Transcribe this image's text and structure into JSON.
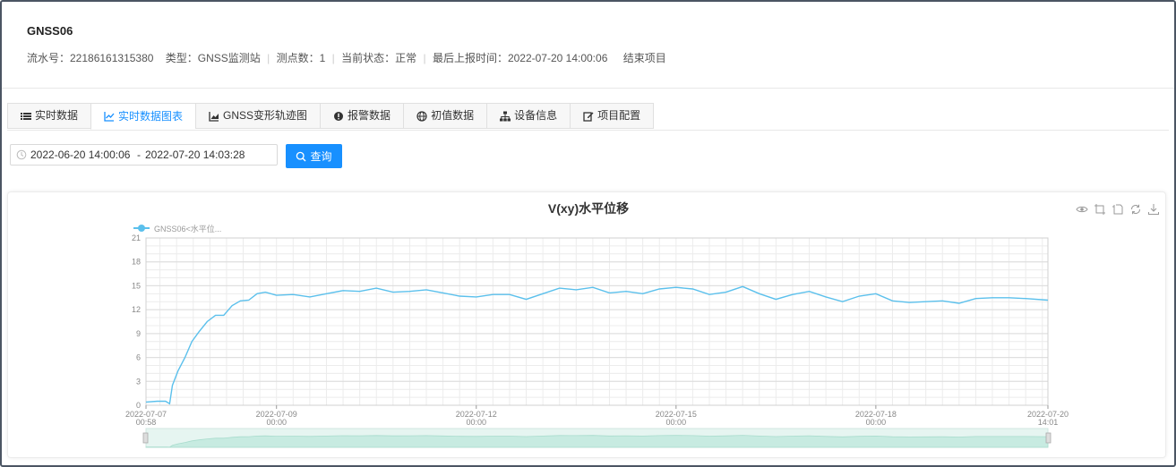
{
  "header": {
    "title": "GNSS06",
    "serial": "流水号：22186161315380",
    "type": "类型：GNSS监测站",
    "points": "测点数：1",
    "status": "当前状态：正常",
    "last_report": "最后上报时间：2022-07-20 14:00:06",
    "end_link": "结束项目"
  },
  "tabs": [
    {
      "label": "实时数据",
      "icon": "list-icon"
    },
    {
      "label": "实时数据图表",
      "icon": "line-chart-icon",
      "active": true
    },
    {
      "label": "GNSS变形轨迹图",
      "icon": "area-chart-icon"
    },
    {
      "label": "报警数据",
      "icon": "alert-icon"
    },
    {
      "label": "初值数据",
      "icon": "globe-icon"
    },
    {
      "label": "设备信息",
      "icon": "sitemap-icon"
    },
    {
      "label": "项目配置",
      "icon": "edit-icon"
    }
  ],
  "filter": {
    "start": "2022-06-20 14:00:06",
    "end": "2022-07-20 14:03:28",
    "range_sep": "-",
    "query_label": "查询"
  },
  "colors": {
    "accent": "#1890ff",
    "series": "#5bc0ec"
  },
  "toolbox": [
    "eye-icon",
    "zoom-select-icon",
    "zoom-reset-icon",
    "restore-icon",
    "download-icon"
  ],
  "chart_data": {
    "type": "line",
    "title": "V(xy)水平位移",
    "xlabel": "",
    "ylabel": "",
    "legend": "top-left",
    "series": [
      {
        "name": "GNSS06<水平位...",
        "points": [
          [
            "2022-07-07 00:58",
            0.4
          ],
          [
            "2022-07-07 05:00",
            0.5
          ],
          [
            "2022-07-07 08:00",
            0.5
          ],
          [
            "2022-07-07 09:30",
            0.2
          ],
          [
            "2022-07-07 10:30",
            2.5
          ],
          [
            "2022-07-07 12:30",
            4.3
          ],
          [
            "2022-07-07 15:00",
            6.0
          ],
          [
            "2022-07-07 17:30",
            8.0
          ],
          [
            "2022-07-07 20:00",
            9.2
          ],
          [
            "2022-07-07 23:00",
            10.5
          ],
          [
            "2022-07-08 02:00",
            11.3
          ],
          [
            "2022-07-08 05:00",
            11.3
          ],
          [
            "2022-07-08 08:00",
            12.5
          ],
          [
            "2022-07-08 11:00",
            13.1
          ],
          [
            "2022-07-08 14:00",
            13.2
          ],
          [
            "2022-07-08 17:00",
            14.0
          ],
          [
            "2022-07-08 20:00",
            14.2
          ],
          [
            "2022-07-09 00:00",
            13.8
          ],
          [
            "2022-07-09 06:00",
            13.9
          ],
          [
            "2022-07-09 12:00",
            13.6
          ],
          [
            "2022-07-09 18:00",
            14.0
          ],
          [
            "2022-07-10 00:00",
            14.4
          ],
          [
            "2022-07-10 06:00",
            14.3
          ],
          [
            "2022-07-10 12:00",
            14.7
          ],
          [
            "2022-07-10 18:00",
            14.2
          ],
          [
            "2022-07-11 00:00",
            14.3
          ],
          [
            "2022-07-11 06:00",
            14.5
          ],
          [
            "2022-07-11 12:00",
            14.1
          ],
          [
            "2022-07-11 18:00",
            13.7
          ],
          [
            "2022-07-12 00:00",
            13.6
          ],
          [
            "2022-07-12 06:00",
            13.9
          ],
          [
            "2022-07-12 12:00",
            13.9
          ],
          [
            "2022-07-12 18:00",
            13.3
          ],
          [
            "2022-07-13 00:00",
            14.0
          ],
          [
            "2022-07-13 06:00",
            14.7
          ],
          [
            "2022-07-13 12:00",
            14.5
          ],
          [
            "2022-07-13 18:00",
            14.8
          ],
          [
            "2022-07-14 00:00",
            14.1
          ],
          [
            "2022-07-14 06:00",
            14.3
          ],
          [
            "2022-07-14 12:00",
            14.0
          ],
          [
            "2022-07-14 18:00",
            14.6
          ],
          [
            "2022-07-15 00:00",
            14.8
          ],
          [
            "2022-07-15 06:00",
            14.6
          ],
          [
            "2022-07-15 12:00",
            13.9
          ],
          [
            "2022-07-15 18:00",
            14.2
          ],
          [
            "2022-07-16 00:00",
            14.9
          ],
          [
            "2022-07-16 06:00",
            14.0
          ],
          [
            "2022-07-16 12:00",
            13.3
          ],
          [
            "2022-07-16 18:00",
            13.9
          ],
          [
            "2022-07-17 00:00",
            14.3
          ],
          [
            "2022-07-17 06:00",
            13.6
          ],
          [
            "2022-07-17 12:00",
            13.0
          ],
          [
            "2022-07-17 18:00",
            13.7
          ],
          [
            "2022-07-18 00:00",
            14.0
          ],
          [
            "2022-07-18 06:00",
            13.1
          ],
          [
            "2022-07-18 12:00",
            12.9
          ],
          [
            "2022-07-18 18:00",
            13.0
          ],
          [
            "2022-07-19 00:00",
            13.1
          ],
          [
            "2022-07-19 06:00",
            12.8
          ],
          [
            "2022-07-19 12:00",
            13.4
          ],
          [
            "2022-07-19 18:00",
            13.5
          ],
          [
            "2022-07-20 00:00",
            13.5
          ],
          [
            "2022-07-20 06:00",
            13.4
          ],
          [
            "2022-07-20 14:01",
            13.2
          ]
        ]
      }
    ],
    "x_range": [
      "2022-07-07 00:58",
      "2022-07-20 14:01"
    ],
    "x_ticks": [
      {
        "date": "2022-07-07",
        "time": "00:58",
        "at": "2022-07-07 00:58"
      },
      {
        "date": "2022-07-09",
        "time": "00:00",
        "at": "2022-07-09 00:00"
      },
      {
        "date": "2022-07-12",
        "time": "00:00",
        "at": "2022-07-12 00:00"
      },
      {
        "date": "2022-07-15",
        "time": "00:00",
        "at": "2022-07-15 00:00"
      },
      {
        "date": "2022-07-18",
        "time": "00:00",
        "at": "2022-07-18 00:00"
      },
      {
        "date": "2022-07-20",
        "time": "14:01",
        "at": "2022-07-20 14:01"
      }
    ],
    "ylim": [
      0,
      21
    ],
    "y_ticks": [
      0,
      3,
      6,
      9,
      12,
      15,
      18,
      21
    ],
    "y_tick_labels": [
      "0",
      "3",
      "6",
      "9",
      "12",
      "15",
      "18",
      "21"
    ],
    "grid": true,
    "datazoom": true
  }
}
